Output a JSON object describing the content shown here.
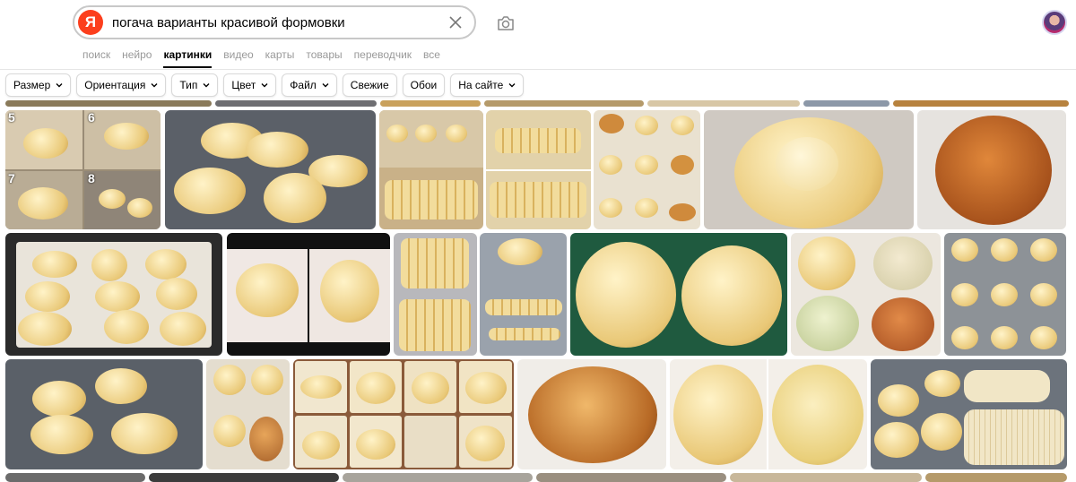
{
  "search": {
    "query": "погача варианты красивой формовки",
    "logo_letter": "Я"
  },
  "tabs": [
    {
      "label": "поиск",
      "active": false
    },
    {
      "label": "нейро",
      "active": false
    },
    {
      "label": "картинки",
      "active": true
    },
    {
      "label": "видео",
      "active": false
    },
    {
      "label": "карты",
      "active": false
    },
    {
      "label": "товары",
      "active": false
    },
    {
      "label": "переводчик",
      "active": false
    },
    {
      "label": "все",
      "active": false
    }
  ],
  "filters": [
    {
      "label": "Размер",
      "dropdown": true
    },
    {
      "label": "Ориентация",
      "dropdown": true
    },
    {
      "label": "Тип",
      "dropdown": true
    },
    {
      "label": "Цвет",
      "dropdown": true
    },
    {
      "label": "Файл",
      "dropdown": true
    },
    {
      "label": "Свежие",
      "dropdown": false
    },
    {
      "label": "Обои",
      "dropdown": false
    },
    {
      "label": "На сайте",
      "dropdown": true
    }
  ],
  "collage_numbers": [
    "5",
    "6",
    "7",
    "8"
  ],
  "colors": {
    "brand": "#fc3f1d",
    "tab_inactive": "#999999"
  }
}
